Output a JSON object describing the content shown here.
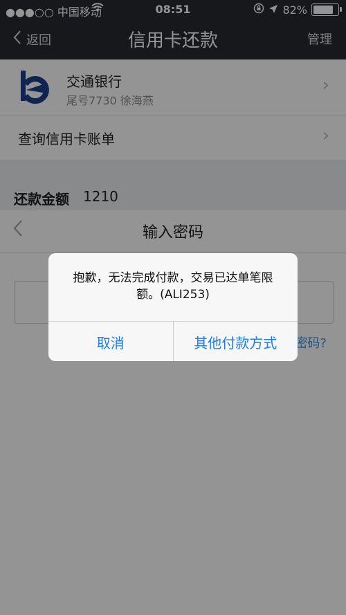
{
  "status_bar": {
    "carrier": "●●●○○ 中国移动",
    "time": "08:51",
    "battery": "82%",
    "battery_level": 0.82
  },
  "nav": {
    "back_label": "返回",
    "title": "信用卡还款",
    "manage_label": "管理"
  },
  "bank": {
    "name": "交通银行",
    "detail": "尾号7730 徐海燕"
  },
  "query_bill_label": "查询信用卡账单",
  "amount": {
    "label": "还款金额",
    "value": "1210"
  },
  "password_sheet": {
    "title": "输入密码",
    "forgot_label": "密码?"
  },
  "alert": {
    "message": "抱歉，无法完成付款，交易已达单笔限额。(ALI253)",
    "cancel_label": "取消",
    "other_label": "其他付款方式"
  },
  "colors": {
    "nav_bg": "#262a31",
    "accent_blue": "#1a7ff0",
    "link_blue": "#3d8fd8",
    "bank_logo": "#1d3f8c"
  },
  "icons": {
    "wifi": "wifi-icon",
    "lock_rotation": "rotation-lock-icon",
    "location": "location-arrow-icon",
    "battery": "battery-icon",
    "chevron": "chevron-right-icon",
    "back": "chevron-left-icon"
  }
}
